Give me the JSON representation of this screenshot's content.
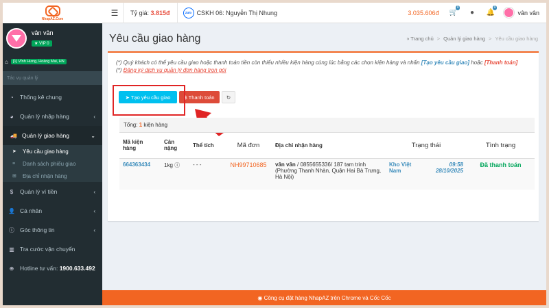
{
  "logo": {
    "text": "NhapAZ.Com"
  },
  "topbar": {
    "exchange_label": "Tỷ giá:",
    "exchange_value": "3.815đ",
    "zalo_label": "Zalo",
    "support": "CSKH 06: Nguyễn Thị Nhung",
    "balance": "3.035.606đ",
    "cart_count": "0",
    "notif_count": "0",
    "username": "vân vân"
  },
  "sidebar": {
    "username": "vân vân",
    "vip": "VIP 0",
    "address": "[1] Vĩnh Hưng, Hoàng Mai, HN",
    "search_placeholder": "Tác vụ quản lý",
    "items": [
      {
        "label": "Thống kê chung"
      },
      {
        "label": "Quản lý nhập hàng"
      },
      {
        "label": "Quản lý giao hàng"
      },
      {
        "label": "Quản lý ví tiền"
      },
      {
        "label": "Cá nhân"
      },
      {
        "label": "Góc thông tin"
      },
      {
        "label": "Tra cước vận chuyển"
      }
    ],
    "sub_items": [
      {
        "label": "Yêu cầu giao hàng"
      },
      {
        "label": "Danh sách phiếu giao"
      },
      {
        "label": "Địa chỉ nhận hàng"
      }
    ],
    "hotline_label": "Hotline tư vấn:",
    "hotline_number": "1900.633.492"
  },
  "page": {
    "title": "Yêu cầu giao hàng",
    "breadcrumb": [
      "Trang chủ",
      "Quản lý giao hàng",
      "Yêu cầu giao hàng"
    ]
  },
  "notice": {
    "line1_prefix": "(*)",
    "line1_text": " Quý khách có thể yêu cầu giao hoặc thanh toán tiền còn thiếu nhiều kiện hàng cùng lúc bằng các chọn kiện hàng và nhấn ",
    "line1_link1": "[Tạo yêu cầu giao]",
    "line1_mid": " hoặc ",
    "line1_link2": "[Thanh toán]",
    "line2_prefix": "(*)",
    "line2_link": "Đăng ký dịch vụ quản lý đơn hàng trọn gói"
  },
  "buttons": {
    "create": "Tạo yêu cầu giao",
    "pay": "Thanh toán"
  },
  "table": {
    "summary_label": "Tổng:",
    "summary_count": "1",
    "summary_unit": "kiện hàng",
    "headers": {
      "code": "Mã kiện hàng",
      "weight": "Cân nặng",
      "volume": "Thể tích",
      "order": "Mã đơn",
      "address": "Địa chỉ nhận hàng",
      "status": "Trạng thái",
      "condition": "Tình trạng"
    },
    "rows": [
      {
        "code": "664363434",
        "weight": "1kg",
        "volume": "- - -",
        "order": "NH99710685",
        "name": "vân vân",
        "address": " / 0855655336/ 187 tam trinh (Phường Thanh Nhàn, Quận Hai Bà Trưng, Hà Nội)",
        "warehouse": "Kho Việt Nam",
        "time": "09:58",
        "date": "28/10/2025",
        "condition": "Đã thanh toán"
      }
    ]
  },
  "footer": {
    "text": "Công cụ đặt hàng NhapAZ trên Chrome và Cốc Cốc"
  }
}
